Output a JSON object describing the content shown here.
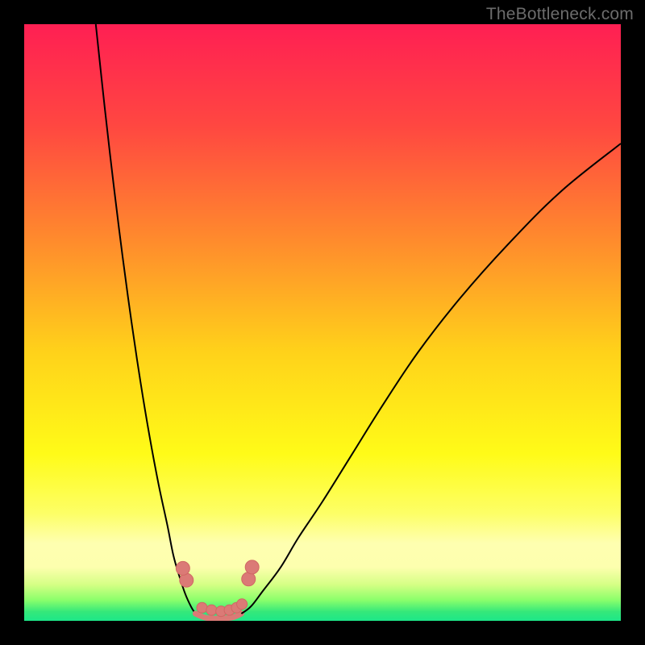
{
  "watermark": {
    "text": "TheBottleneck.com"
  },
  "colors": {
    "frame": "#000000",
    "watermark": "#6c6c6c",
    "curve_stroke": "#000000",
    "marker_fill": "#db7a76",
    "marker_stroke": "#d06763",
    "gradient_stops": [
      {
        "offset": 0.0,
        "color": "#ff1f53"
      },
      {
        "offset": 0.17,
        "color": "#ff4741"
      },
      {
        "offset": 0.36,
        "color": "#ff8a2d"
      },
      {
        "offset": 0.55,
        "color": "#ffd21a"
      },
      {
        "offset": 0.72,
        "color": "#fffb18"
      },
      {
        "offset": 0.82,
        "color": "#fdff66"
      },
      {
        "offset": 0.87,
        "color": "#feffb0"
      },
      {
        "offset": 0.91,
        "color": "#fdffae"
      },
      {
        "offset": 0.94,
        "color": "#d4ff84"
      },
      {
        "offset": 0.965,
        "color": "#8bff6b"
      },
      {
        "offset": 0.985,
        "color": "#34e87a"
      },
      {
        "offset": 1.0,
        "color": "#1de789"
      }
    ]
  },
  "chart_data": {
    "type": "line",
    "title": "",
    "xlabel": "",
    "ylabel": "",
    "xlim": [
      0,
      100
    ],
    "ylim": [
      0,
      100
    ],
    "grid": false,
    "legend": false,
    "series": [
      {
        "name": "left-branch",
        "x": [
          12,
          13.5,
          15,
          16.5,
          18,
          19.5,
          21,
          22.5,
          24,
          25,
          26,
          27,
          28,
          28.7
        ],
        "y": [
          100,
          86,
          73,
          61,
          50,
          40,
          31,
          23,
          16,
          11,
          7.5,
          4.5,
          2.3,
          1.2
        ]
      },
      {
        "name": "right-branch",
        "x": [
          36.4,
          38,
          40,
          43,
          46,
          50,
          55,
          60,
          66,
          73,
          81,
          90,
          100
        ],
        "y": [
          1.2,
          2.4,
          5,
          9,
          14,
          20,
          28,
          36,
          45,
          54,
          63,
          72,
          80
        ]
      },
      {
        "name": "valley-floor",
        "x": [
          28.7,
          30.5,
          33,
          35,
          36.4
        ],
        "y": [
          1.2,
          0.5,
          0.4,
          0.6,
          1.2
        ]
      }
    ],
    "markers": [
      {
        "name": "left-pair-low",
        "x": 27.2,
        "y": 6.8
      },
      {
        "name": "left-pair-high",
        "x": 26.6,
        "y": 8.8
      },
      {
        "name": "right-pair-low",
        "x": 37.6,
        "y": 7.0
      },
      {
        "name": "right-pair-high",
        "x": 38.2,
        "y": 9.0
      },
      {
        "name": "floor-1",
        "x": 29.8,
        "y": 2.2
      },
      {
        "name": "floor-2",
        "x": 31.4,
        "y": 1.8
      },
      {
        "name": "floor-3",
        "x": 33.0,
        "y": 1.6
      },
      {
        "name": "floor-4",
        "x": 34.4,
        "y": 1.8
      },
      {
        "name": "floor-5",
        "x": 35.6,
        "y": 2.2
      },
      {
        "name": "floor-6",
        "x": 36.5,
        "y": 2.8
      }
    ]
  }
}
